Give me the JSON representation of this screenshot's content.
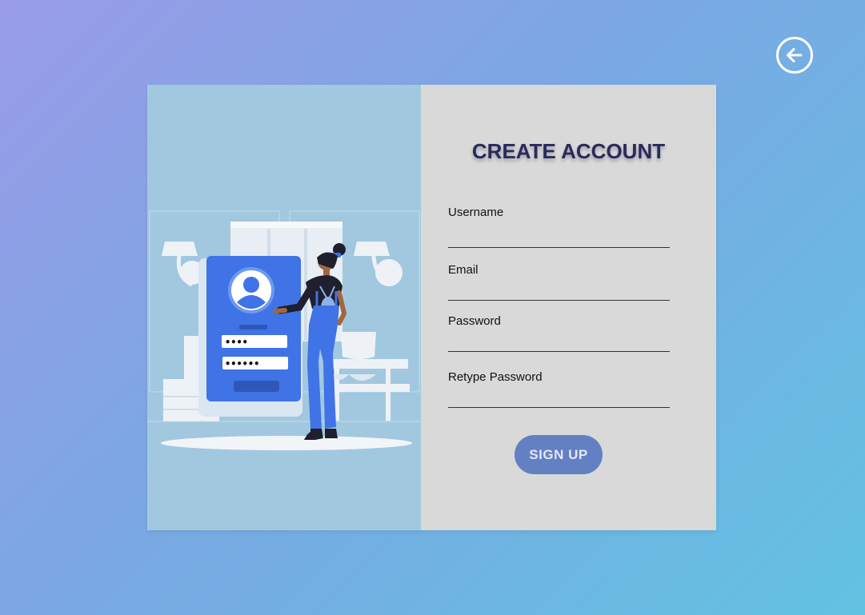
{
  "nav": {
    "back_icon": "arrow-left-circle-icon"
  },
  "illustration": {
    "pin_mask_short": "••••",
    "pin_mask_long": "••••••",
    "avatar_icon": "user-avatar-icon"
  },
  "form": {
    "title": "CREATE ACCOUNT",
    "fields": [
      {
        "label": "Username",
        "value": ""
      },
      {
        "label": "Email",
        "value": ""
      },
      {
        "label": "Password",
        "value": ""
      },
      {
        "label": "Retype Password",
        "value": ""
      }
    ],
    "submit_label": "SIGN UP"
  },
  "colors": {
    "title": "#2a2a5a",
    "button": "#6380c3",
    "form_panel": "#d9d9d9",
    "illustration_panel": "#a2c8e0",
    "phone": "#3f73e6"
  }
}
